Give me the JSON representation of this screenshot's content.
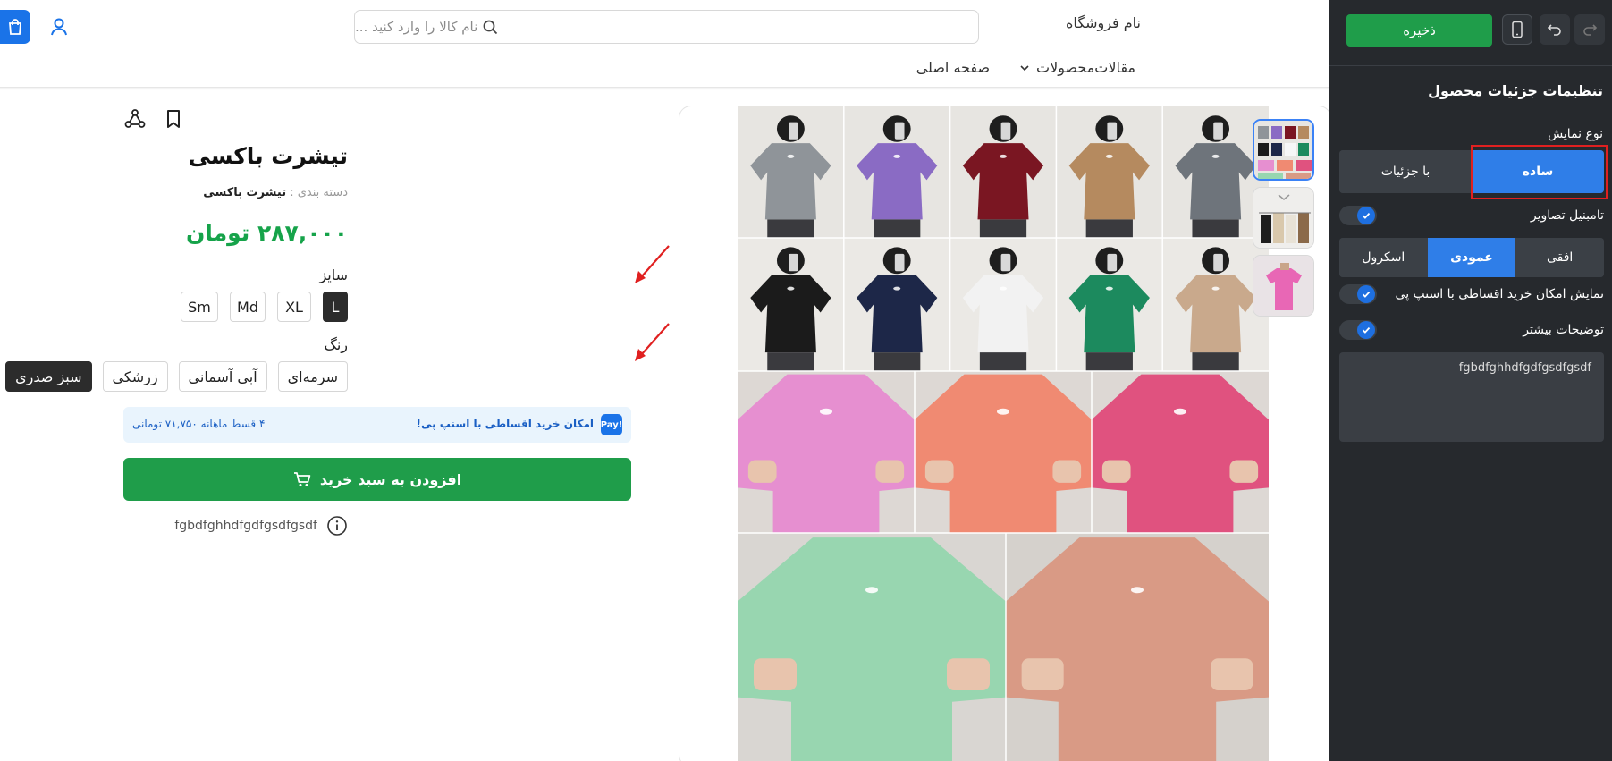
{
  "header": {
    "store_name": "نام فروشگاه",
    "search_placeholder": "نام کالا را وارد کنید ...",
    "nav": [
      "صفحه اصلی",
      "محصولات",
      "مقالات"
    ]
  },
  "product": {
    "title": "تیشرت باکسی",
    "category_label": "دسته بندی :",
    "category_value": "تیشرت باکسی",
    "price": "۲۸۷,۰۰۰ تومان",
    "size_label": "سایز",
    "sizes": [
      "L",
      "XL",
      "Md",
      "Sm"
    ],
    "selected_size": "L",
    "color_label": "رنگ",
    "colors": [
      "سبز صدری",
      "زرشکی",
      "آبی آسمانی",
      "سرمه‌ای"
    ],
    "selected_color": "سبز صدری",
    "snappay_logo": "Pay!",
    "snappay_text": "امکان خرید اقساطی با اسنپ پی!",
    "snappay_installment": "۴ قسط ماهانه ۷۱,۷۵۰ تومانی",
    "add_to_cart": "افزودن به سبد خرید",
    "description": "fgbdfghhdfgdfgsdfgsdf"
  },
  "panel": {
    "save_label": "ذخیره",
    "title": "تنظیمات جزئیات محصول",
    "display_type_label": "نوع نمایش",
    "display_type_options": [
      "ساده",
      "با جزئیات"
    ],
    "display_type_selected": "ساده",
    "thumbnail_label": "تامبنیل تصاویر",
    "thumbnail_enabled": true,
    "thumbnail_layout_options": [
      "افقی",
      "عمودی",
      "اسکرول"
    ],
    "thumbnail_layout_selected": "عمودی",
    "snappay_toggle_label": "نمایش امکان خرید اقساطی با اسنپ پی",
    "snappay_toggle_enabled": true,
    "more_desc_label": "توضیحات بیشتر",
    "more_desc_enabled": true,
    "more_desc_value": "fgbdfghhdfgdfgsdfgsdf"
  },
  "colors": {
    "accent_blue": "#2f7ee8",
    "cart_green": "#1f9d4a",
    "price_green": "#16a34a",
    "panel_bg": "#26292d",
    "highlight_red": "#e02020"
  },
  "gallery": {
    "row1_shirts": [
      "#8f9499",
      "#8a6bc4",
      "#7a1622",
      "#b58a5f",
      "#6e747b"
    ],
    "row2_shirts": [
      "#1b1b1b",
      "#1d2748",
      "#f2f2f2",
      "#1c8a5e",
      "#c9a98c"
    ],
    "row3_shirts": [
      "#e68fd0",
      "#f08a72",
      "#e0527f"
    ],
    "row4_shirts": [
      "#98d6b0",
      "#d99a85"
    ]
  }
}
